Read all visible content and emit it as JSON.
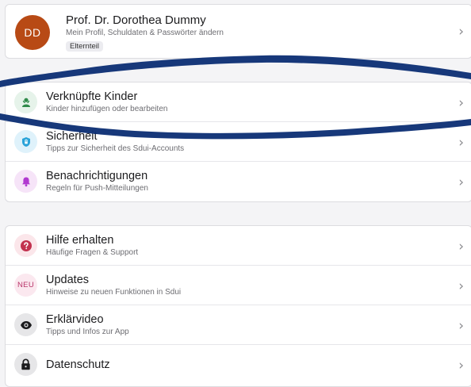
{
  "profile": {
    "initials": "DD",
    "name": "Prof. Dr. Dorothea Dummy",
    "subtitle": "Mein Profil, Schuldaten & Passwörter ändern",
    "role_badge": "Elternteil",
    "avatar_color": "#b84a15"
  },
  "settings": [
    {
      "title": "Verknüpfte Kinder",
      "subtitle": "Kinder hinzufügen oder bearbeiten",
      "icon": "child-icon",
      "icon_bg": "#e6f3ea",
      "icon_color": "#2f8a4a"
    },
    {
      "title": "Sicherheit",
      "subtitle": "Tipps zur Sicherheit des Sdui-Accounts",
      "icon": "lock-shield-icon",
      "icon_bg": "#dff2fb",
      "icon_color": "#2aa3d9"
    },
    {
      "title": "Benachrichtigungen",
      "subtitle": "Regeln für Push-Mitteilungen",
      "icon": "bell-icon",
      "icon_bg": "#f6e4f8",
      "icon_color": "#b13ad0"
    }
  ],
  "support": [
    {
      "title": "Hilfe erhalten",
      "subtitle": "Häufige Fragen & Support",
      "icon": "question-icon",
      "icon_bg": "#fbe6ea",
      "icon_color": "#c2324f"
    },
    {
      "title": "Updates",
      "subtitle": "Hinweise zu neuen Funktionen in Sdui",
      "icon_text": "NEU",
      "icon_bg": "#fbe8ef",
      "icon_color": "#b9356a"
    },
    {
      "title": "Erklärvideo",
      "subtitle": "Tipps und Infos zur App",
      "icon": "eye-icon",
      "icon_bg": "#e6e6e8",
      "icon_color": "#1c1c1e"
    },
    {
      "title": "Datenschutz",
      "subtitle": "",
      "icon": "padlock-icon",
      "icon_bg": "#e6e6e8",
      "icon_color": "#1c1c1e"
    }
  ],
  "chevron": "›",
  "annotation_color": "#0b2d73"
}
